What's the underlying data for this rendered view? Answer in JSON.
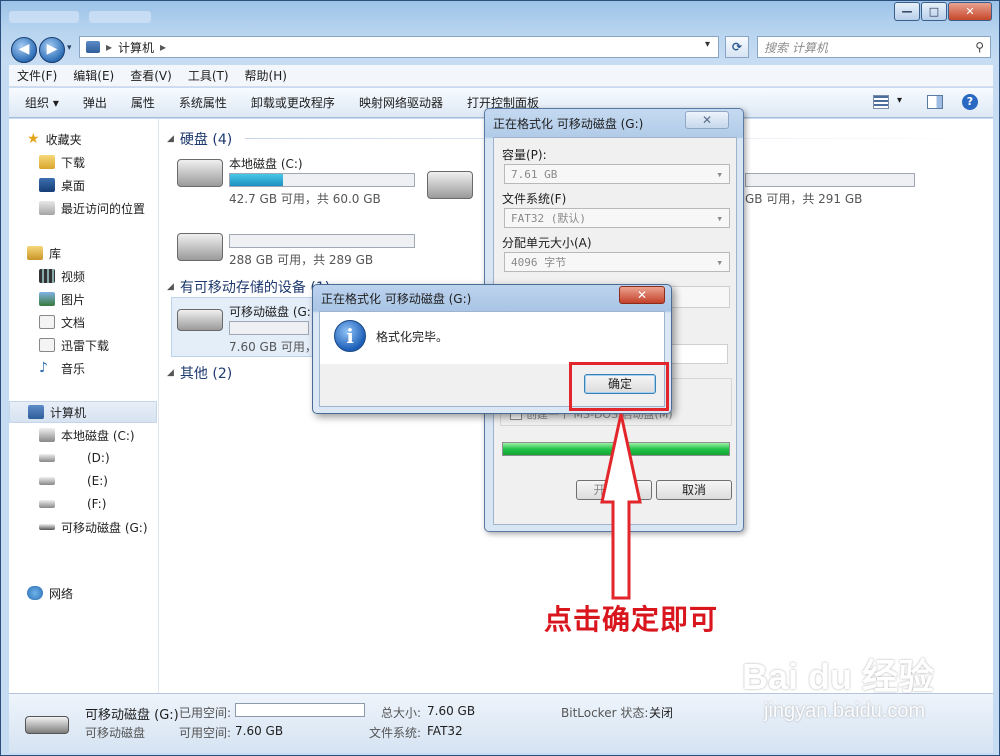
{
  "explorer": {
    "address": {
      "computer": "计算机"
    },
    "search_placeholder": "搜索 计算机",
    "menu": [
      "文件(F)",
      "编辑(E)",
      "查看(V)",
      "工具(T)",
      "帮助(H)"
    ],
    "toolbar": [
      "组织",
      "弹出",
      "属性",
      "系统属性",
      "卸载或更改程序",
      "映射网络驱动器",
      "打开控制面板"
    ],
    "sidebar": {
      "favorites": {
        "label": "收藏夹",
        "items": [
          "下载",
          "桌面",
          "最近访问的位置"
        ]
      },
      "libraries": {
        "label": "库",
        "items": [
          "视频",
          "图片",
          "文档",
          "迅雷下载",
          "音乐"
        ]
      },
      "computer": {
        "label": "计算机",
        "items": [
          "本地磁盘 (C:)",
          "(D:)",
          "(E:)",
          "(F:)",
          "可移动磁盘 (G:)"
        ]
      },
      "network": "网络"
    },
    "groups": {
      "hdd": "硬盘 (4)",
      "removable": "有可移动存储的设备 (1)",
      "other": "其他 (2)"
    },
    "drives": {
      "c": {
        "name": "本地磁盘 (C:)",
        "info": "42.7 GB 可用，共 60.0 GB",
        "used_fraction": 0.29
      },
      "d": {
        "info": "288 GB 可用，共 289 GB",
        "used_fraction": 0.0
      },
      "f": {
        "info": "GB 可用，共 291 GB",
        "used_fraction": 0.0
      },
      "g": {
        "name": "可移动磁盘 (G:)",
        "info": "7.60 GB 可用，"
      }
    },
    "details": {
      "name": "可移动磁盘 (G:)",
      "type": "可移动磁盘",
      "used_label": "已用空间:",
      "free_label": "可用空间:",
      "free_value": "7.60 GB",
      "total_label": "总大小:",
      "total_value": "7.60 GB",
      "fs_label": "文件系统:",
      "fs_value": "FAT32",
      "bitlocker_label": "BitLocker 状态:",
      "bitlocker_value": "关闭"
    }
  },
  "format_dialog": {
    "title": "正在格式化 可移动磁盘 (G:)",
    "capacity_label": "容量(P):",
    "capacity_value": "7.61 GB",
    "fs_label": "文件系统(F)",
    "fs_value": "FAT32 (默认)",
    "alloc_label": "分配单元大小(A)",
    "alloc_value": "4096 字节",
    "msdos_option": "创建一个 MS-DOS 启动盘(M)",
    "progress": 1.0,
    "start_button": "开始(S)",
    "cancel_button": "取消"
  },
  "done_dialog": {
    "title": "正在格式化 可移动磁盘 (G:)",
    "message": "格式化完毕。",
    "ok_button": "确定"
  },
  "annotation": "点击确定即可",
  "watermark": {
    "brand": "Bai du 经验",
    "url": "jingyan.baidu.com"
  },
  "colors": {
    "annotation_red": "#e2262b",
    "progress_green": "#22c44a",
    "disk_bar": "#1f90c1"
  }
}
